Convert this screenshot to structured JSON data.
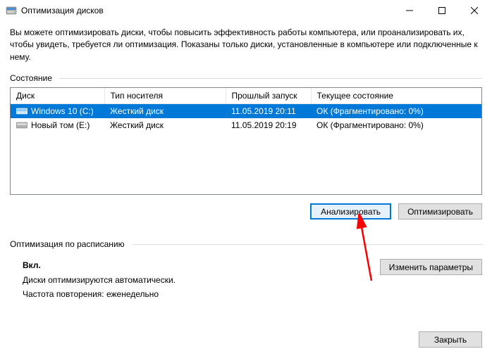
{
  "window": {
    "title": "Оптимизация дисков"
  },
  "intro": "Вы можете оптимизировать диски, чтобы повысить эффективность работы  компьютера, или проанализировать их, чтобы увидеть, требуется ли оптимизация. Показаны только диски, установленные в компьютере или подключенные к нему.",
  "state_label": "Состояние",
  "table": {
    "headers": {
      "disk": "Диск",
      "media": "Тип носителя",
      "last": "Прошлый запуск",
      "status": "Текущее состояние"
    },
    "rows": [
      {
        "name": "Windows 10 (C:)",
        "media": "Жесткий диск",
        "last": "11.05.2019 20:11",
        "status": "ОК (Фрагментировано: 0%)",
        "selected": true
      },
      {
        "name": "Новый том (E:)",
        "media": "Жесткий диск",
        "last": "11.05.2019 20:19",
        "status": "ОК (Фрагментировано: 0%)",
        "selected": false
      }
    ]
  },
  "buttons": {
    "analyze": "Анализировать",
    "optimize": "Оптимизировать",
    "change_params": "Изменить параметры",
    "close": "Закрыть"
  },
  "schedule": {
    "label": "Оптимизация по расписанию",
    "on": "Вкл.",
    "line1": "Диски оптимизируются автоматически.",
    "line2": "Частота повторения: еженедельно"
  }
}
